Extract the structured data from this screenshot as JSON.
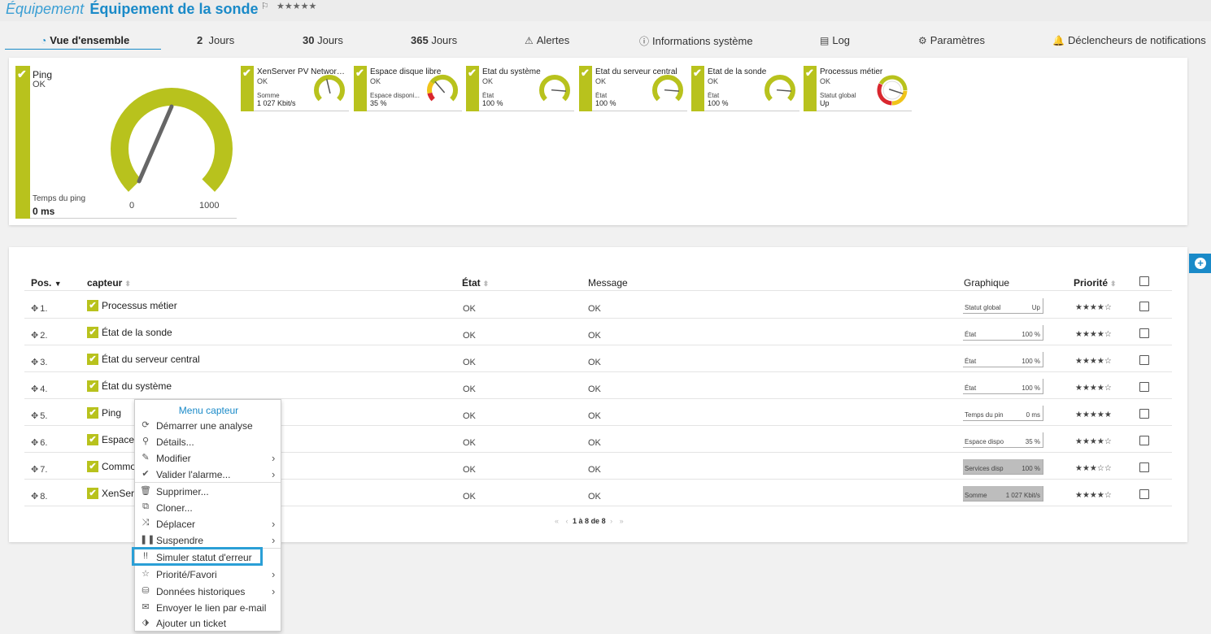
{
  "header": {
    "kind": "Équipement",
    "name": "Équipement de la sonde",
    "flag": "⚐",
    "stars": "★★★★★"
  },
  "tabs": [
    {
      "label": "Vue d'ensemble"
    },
    {
      "number": "2",
      "label": "Jours"
    },
    {
      "number": "30",
      "label": "Jours"
    },
    {
      "number": "365",
      "label": "Jours"
    },
    {
      "label": "Alertes"
    },
    {
      "label": "Informations système"
    },
    {
      "label": "Log"
    },
    {
      "label": "Paramètres"
    },
    {
      "label": "Déclencheurs de notifications"
    }
  ],
  "colors": {
    "accent": "#1a8ac8",
    "ok_green": "#b8c21d",
    "error_red": "#d9272e",
    "warn_yellow": "#f0c419"
  },
  "gauge_ping": {
    "name": "Ping",
    "status": "OK",
    "channel": "Temps du ping",
    "value": "0 ms",
    "min": "0",
    "max": "1000",
    "fraction": 0.5
  },
  "mini_gauges": [
    {
      "name": "XenServer PV Network De...",
      "status": "OK",
      "channel": "Somme",
      "value": "1 027 Kbit/s",
      "fraction": 0.45,
      "scheme": "green"
    },
    {
      "name": "Espace disque libre",
      "status": "OK",
      "channel": "Espace disponi...",
      "value": "35 %",
      "fraction": 0.35,
      "scheme": "threshold"
    },
    {
      "name": "État du système",
      "status": "OK",
      "channel": "État",
      "value": "100 %",
      "fraction": 0.85,
      "scheme": "green"
    },
    {
      "name": "État du serveur central",
      "status": "OK",
      "channel": "État",
      "value": "100 %",
      "fraction": 0.85,
      "scheme": "green"
    },
    {
      "name": "État de la sonde",
      "status": "OK",
      "channel": "État",
      "value": "100 %",
      "fraction": 0.85,
      "scheme": "green"
    },
    {
      "name": "Processus métier",
      "status": "OK",
      "channel": "Statut global",
      "value": "Up",
      "fraction": 0.9,
      "scheme": "ring"
    }
  ],
  "table": {
    "headers": {
      "pos": "Pos.",
      "sensor": "capteur",
      "state": "État",
      "message": "Message",
      "graph": "Graphique",
      "priority": "Priorité"
    },
    "rows": [
      {
        "pos": "1.",
        "name": "Processus métier",
        "state": "OK",
        "message": "OK",
        "graph_label": "Statut global",
        "graph_value": "Up",
        "priority": "★★★★☆",
        "dark": false
      },
      {
        "pos": "2.",
        "name": "État de la sonde",
        "state": "OK",
        "message": "OK",
        "graph_label": "État",
        "graph_value": "100 %",
        "priority": "★★★★☆",
        "dark": false
      },
      {
        "pos": "3.",
        "name": "État du serveur central",
        "state": "OK",
        "message": "OK",
        "graph_label": "État",
        "graph_value": "100 %",
        "priority": "★★★★☆",
        "dark": false
      },
      {
        "pos": "4.",
        "name": "État du système",
        "state": "OK",
        "message": "OK",
        "graph_label": "État",
        "graph_value": "100 %",
        "priority": "★★★★☆",
        "dark": false
      },
      {
        "pos": "5.",
        "name": "Ping",
        "state": "OK",
        "message": "OK",
        "graph_label": "Temps du pin",
        "graph_value": "0 ms",
        "priority": "★★★★★",
        "dark": false
      },
      {
        "pos": "6.",
        "name": "Espace",
        "state": "OK",
        "message": "OK",
        "graph_label": "Espace dispo",
        "graph_value": "35 %",
        "priority": "★★★★☆",
        "dark": false
      },
      {
        "pos": "7.",
        "name": "Commo",
        "state": "OK",
        "message": "OK",
        "graph_label": "Services disp",
        "graph_value": "100 %",
        "priority": "★★★☆☆",
        "dark": true
      },
      {
        "pos": "8.",
        "name": "XenServ",
        "state": "OK",
        "message": "OK",
        "graph_label": "Somme",
        "graph_value": "1 027 Kbit/s",
        "priority": "★★★★☆",
        "dark": true
      }
    ],
    "pager": "1 à 8 de 8"
  },
  "context_menu": {
    "title": "Menu capteur",
    "items": [
      {
        "label": "Démarrer une analyse",
        "icon": "refresh-icon",
        "glyph": "⟳",
        "submenu": false
      },
      {
        "label": "Détails...",
        "icon": "search-icon",
        "glyph": "⚲",
        "submenu": false
      },
      {
        "label": "Modifier",
        "icon": "edit-icon",
        "glyph": "✎",
        "submenu": true
      },
      {
        "label": "Valider l'alarme...",
        "icon": "check-icon",
        "glyph": "✔",
        "submenu": true
      },
      {
        "label": "Supprimer...",
        "icon": "trash-icon",
        "glyph": "🗑",
        "submenu": false
      },
      {
        "label": "Cloner...",
        "icon": "clone-icon",
        "glyph": "⧉",
        "submenu": false
      },
      {
        "label": "Déplacer",
        "icon": "shuffle-icon",
        "glyph": "⤨",
        "submenu": true
      },
      {
        "label": "Suspendre",
        "icon": "pause-icon",
        "glyph": "❚❚",
        "submenu": true
      },
      {
        "label": "Simuler statut d'erreur",
        "icon": "error-simulate-icon",
        "glyph": "!!",
        "submenu": false
      },
      {
        "label": "Priorité/Favori",
        "icon": "star-icon",
        "glyph": "☆",
        "submenu": true
      },
      {
        "label": "Données historiques",
        "icon": "database-icon",
        "glyph": "⛁",
        "submenu": true
      },
      {
        "label": "Envoyer le lien par e-mail",
        "icon": "mail-icon",
        "glyph": "✉",
        "submenu": false
      },
      {
        "label": "Ajouter un ticket",
        "icon": "ticket-icon",
        "glyph": "⬗",
        "submenu": false
      }
    ]
  }
}
